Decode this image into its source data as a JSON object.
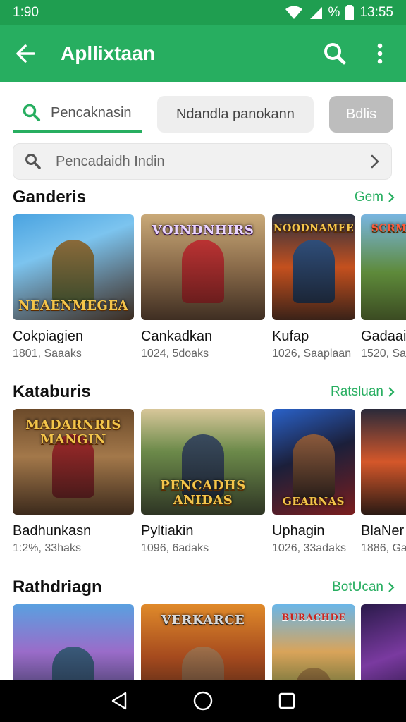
{
  "status_bar": {
    "time": "1:90",
    "battery_text": "%",
    "clock_right": "13:55"
  },
  "app_bar": {
    "title": "Apllixtaan"
  },
  "tabs": {
    "active_label": "Pencaknasin",
    "chip_label": "Ndandla panokann",
    "button_label": "Bdlis"
  },
  "search": {
    "placeholder": "Pencadaidh Indin"
  },
  "sections": [
    {
      "title": "Ganderis",
      "link": "Gem",
      "cards": [
        {
          "name": "Cokpiagien",
          "meta": "1801, Saaaks",
          "art_text": "NEAENMEGEA"
        },
        {
          "name": "Cankadkan",
          "meta": "1024, 5doaks",
          "art_text": "VOINDNHIRS"
        },
        {
          "name": "Kufap",
          "meta": "1026, Saaplaan",
          "art_text": "NOODNAMEE"
        },
        {
          "name": "Gadaai",
          "meta": "1520, Sa",
          "art_text": "SCRM"
        }
      ]
    },
    {
      "title": "Kataburis",
      "link": "Ratsluan",
      "cards": [
        {
          "name": "Badhunkasn",
          "meta": "1:2%, 33haks",
          "art_text": "MADARNRIS MANGIN"
        },
        {
          "name": "Pyltiakin",
          "meta": "1096, 6adaks",
          "art_text": "PENCADHS ANIDAS"
        },
        {
          "name": "Uphagin",
          "meta": "1026, 33adaks",
          "art_text": "GEARNAS"
        },
        {
          "name": "BlaNer",
          "meta": "1886, Ga",
          "art_text": ""
        }
      ]
    },
    {
      "title": "Rathdriagn",
      "link": "BotUcan",
      "cards": [
        {
          "name": "",
          "meta": "",
          "art_text": ""
        },
        {
          "name": "",
          "meta": "",
          "art_text": "VERKARCE"
        },
        {
          "name": "",
          "meta": "",
          "art_text": "BURACHDE"
        },
        {
          "name": "",
          "meta": "",
          "art_text": ""
        }
      ]
    }
  ],
  "colors": {
    "primary": "#27ae60",
    "status": "#1f9e50",
    "nav": "#000000"
  }
}
